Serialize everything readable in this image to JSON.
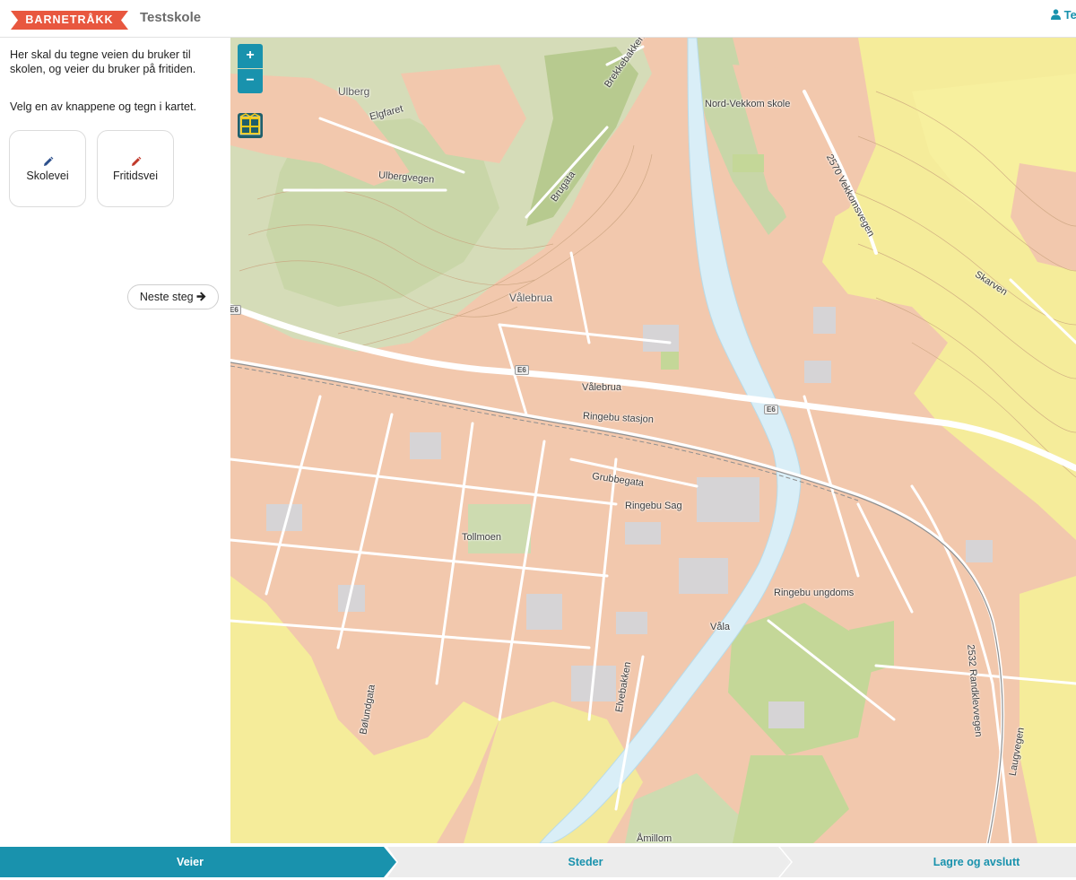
{
  "header": {
    "logo_text": "BARNETRÅKK",
    "school": "Testskole",
    "user": "Tes"
  },
  "sidebar": {
    "intro": "Her skal du tegne veien du bruker til skolen, og veier du bruker på fritiden.",
    "instruction": "Velg en av knappene og tegn i kartet.",
    "buttons": [
      {
        "label": "Skolevei",
        "icon": "pencil-icon",
        "color": "#2c4f8c"
      },
      {
        "label": "Fritidsvei",
        "icon": "pencil-icon",
        "color": "#c0392b"
      }
    ],
    "next_label": "Neste steg"
  },
  "map": {
    "zoom_in": "+",
    "zoom_out": "−",
    "labels": {
      "ulberg": "Ulberg",
      "elgfaret": "Elgfaret",
      "ulbergvegen": "Ulbergvegen",
      "brekkebakken": "Brekkebakken",
      "brugata": "Brugata",
      "nord_vekkom": "Nord-Vekkom skole",
      "vekkomsvegen": "2570 Vekkomsvegen",
      "skarven": "Skarven",
      "valebrua_place": "Vålebrua",
      "valebrua_road": "Vålebrua",
      "ringebu_stasjon": "Ringebu stasjon",
      "grubbegata": "Grubbegata",
      "ringebu_sag": "Ringebu Sag",
      "tollmoen": "Tollmoen",
      "ringebu_ungdoms": "Ringebu ungdoms",
      "vala": "Våla",
      "randklevvegen": "2532 Randklevvegen",
      "bolundgata": "Bølundgata",
      "elvebakken": "Elvebakken",
      "laugvegen": "Laugvegen",
      "amillom": "Åmillom",
      "e6_a": "E6",
      "e6_b": "E6",
      "e6_c": "E6"
    }
  },
  "steps": [
    {
      "label": "Veier",
      "active": true
    },
    {
      "label": "Steder",
      "active": false
    },
    {
      "label": "Lagre og avslutt",
      "active": false
    }
  ],
  "colors": {
    "accent": "#1992ad",
    "logo": "#e8573f",
    "step_inactive": "#ececec"
  }
}
